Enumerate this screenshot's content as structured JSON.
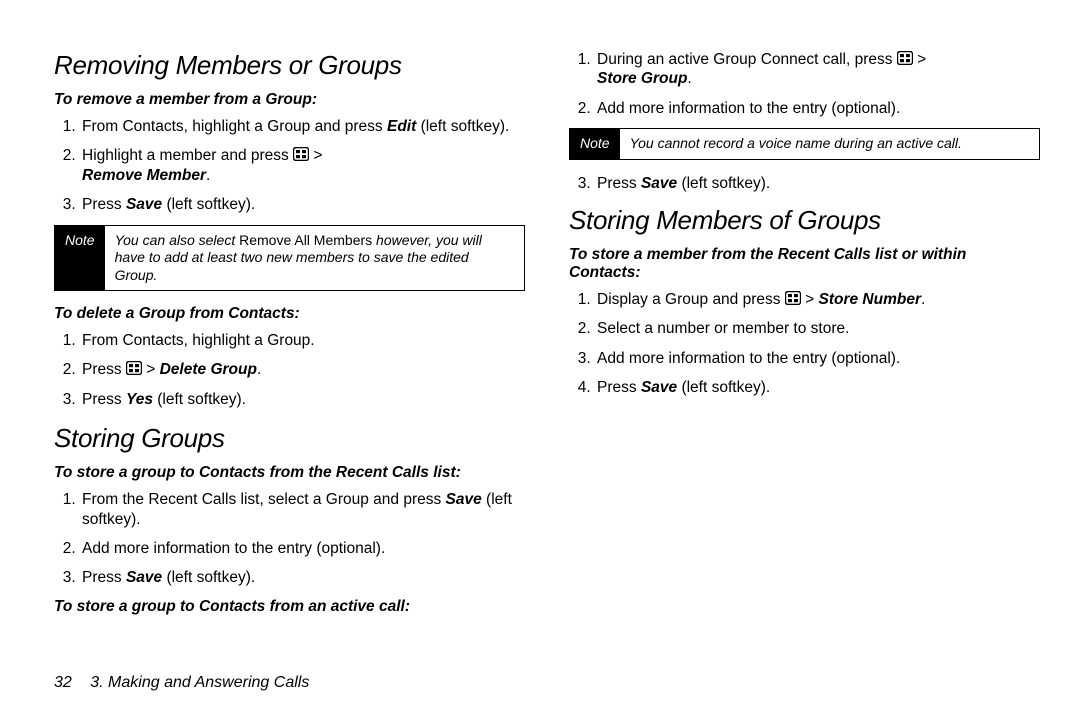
{
  "left": {
    "h1": "Removing Members or Groups",
    "sub1": "To remove a member from a Group:",
    "s1a_pre": "From Contacts, highlight a Group and press ",
    "s1a_edit": "Edit",
    "s1a_post": " (left softkey).",
    "s1b_pre": "Highlight a member and press ",
    "s1b_gt": " >",
    "s1b_rm": "Remove Member",
    "s1b_dot": ".",
    "s1c_pre": "Press ",
    "s1c_save": "Save",
    "s1c_post": " (left softkey).",
    "note_label": "Note",
    "note1_a": "You can also select ",
    "note1_b": "Remove All Members",
    "note1_c": " however, you will have to add at least two new members to save the edited Group.",
    "sub2": "To delete a Group from Contacts:",
    "s2a": "From Contacts, highlight a Group.",
    "s2b_pre": "Press ",
    "s2b_gt": " > ",
    "s2b_dg": "Delete Group",
    "s2b_dot": ".",
    "s2c_pre": "Press ",
    "s2c_yes": "Yes",
    "s2c_post": " (left softkey).",
    "h2": "Storing Groups",
    "sub3": "To store a group to Contacts from the Recent Calls list:",
    "s3a_pre": "From the Recent Calls list, select a Group and press ",
    "s3a_save": "Save",
    "s3a_post": " (left softkey)."
  },
  "right": {
    "r2": "Add more information to the entry (optional).",
    "r3_pre": "Press ",
    "r3_save": "Save",
    "r3_post": " (left softkey).",
    "sub4": "To store a group to Contacts from an active call:",
    "s4a_pre": "During an active Group Connect call, press ",
    "s4a_gt": " >",
    "s4a_sg": "Store Group",
    "s4a_dot": ".",
    "s4b": "Add more information to the entry (optional).",
    "note_label": "Note",
    "note2": "You cannot record a voice name during an active call.",
    "s4c_pre": "Press ",
    "s4c_save": "Save",
    "s4c_post": " (left softkey).",
    "h3": "Storing Members of Groups",
    "sub5": "To store a member from the Recent Calls list or within Contacts:",
    "s5a_pre": "Display a Group and press ",
    "s5a_gt": " > ",
    "s5a_sn": "Store Number",
    "s5a_dot": ".",
    "s5b": "Select a number or member to store.",
    "s5c": "Add more information to the entry (optional).",
    "s5d_pre": "Press ",
    "s5d_save": "Save",
    "s5d_post": " (left softkey)."
  },
  "footer": {
    "page": "32",
    "chapter": "3. Making and Answering Calls"
  },
  "icons": {
    "options": "options-key-icon"
  }
}
